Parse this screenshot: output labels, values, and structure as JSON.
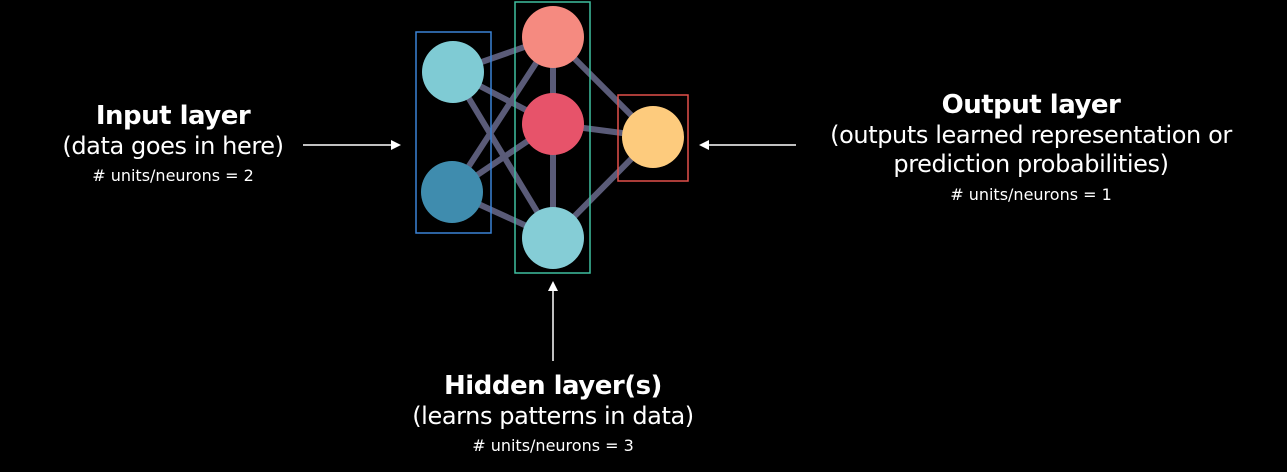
{
  "colors": {
    "background": "#000000",
    "connection": "#5a5b78",
    "input_box": "#3b82d6",
    "hidden_box": "#3fbfa0",
    "output_box": "#e2504a",
    "input_node_top": "#7fcbd4",
    "input_node_bottom": "#3f8cae",
    "hidden_node_top": "#f58a80",
    "hidden_node_middle": "#e7536a",
    "hidden_node_bottom": "#85cdd6",
    "output_node": "#fdcb7d",
    "arrow": "#ffffff"
  },
  "layers": {
    "input": {
      "title": "Input layer",
      "description": "(data goes in here)",
      "units": "# units/neurons = 2",
      "node_count": 2
    },
    "hidden": {
      "title": "Hidden layer(s)",
      "description": "(learns patterns in data)",
      "units": "# units/neurons = 3",
      "node_count": 3
    },
    "output": {
      "title": "Output layer",
      "description_line1": "(outputs learned representation or",
      "description_line2": "prediction probabilities)",
      "units": "# units/neurons = 1",
      "node_count": 1
    }
  }
}
